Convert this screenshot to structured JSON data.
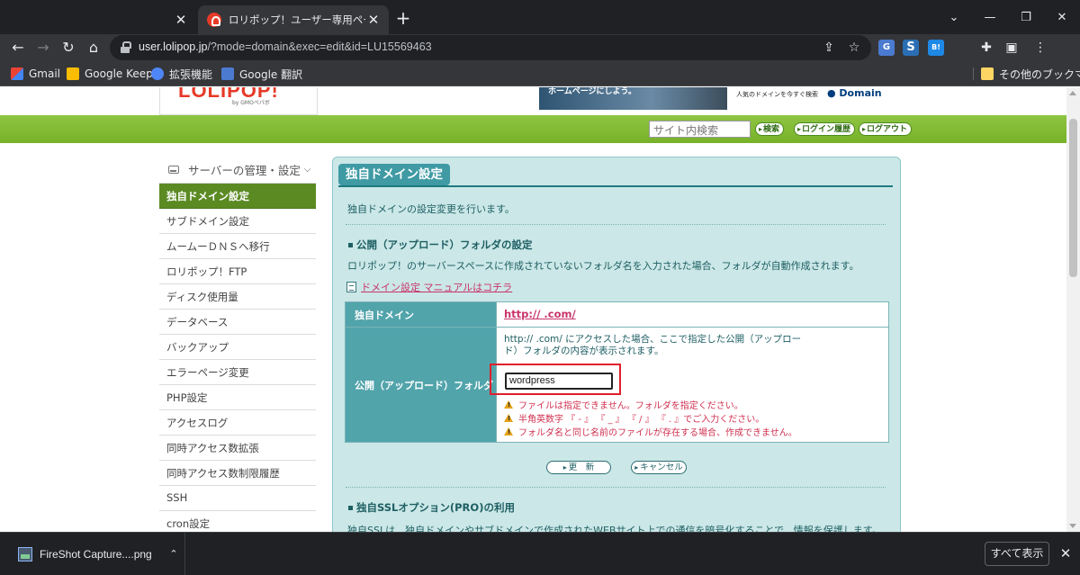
{
  "browser": {
    "tabs": [
      {
        "title": "",
        "active": false
      },
      {
        "title": "ロリポップ！ユーザー専用ページ - 独自",
        "active": true
      }
    ],
    "url_host": "user.lolipop.jp",
    "url_path": "/?mode=domain&exec=edit&id=LU15569463",
    "bookmarks": [
      "Gmail",
      "Google Keep",
      "拡張機能",
      "Google 翻訳"
    ],
    "other_bookmarks": "その他のブックマーク"
  },
  "site": {
    "logo": "LOLIPOP!",
    "logo_sub": "by GMOペパボ",
    "banner_left": "ホームページにしよう。",
    "banner_right": "人気のドメインを今すぐ検索",
    "banner_brand": "● Domain",
    "search_placeholder": "サイト内検索",
    "search_button": "検索",
    "login_history_button": "ログイン履歴",
    "logout_button": "ログアウト"
  },
  "sidebar": {
    "header": "サーバーの管理・設定",
    "items": [
      "独自ドメイン設定",
      "サブドメイン設定",
      "ムームーＤＮＳへ移行",
      "ロリポップ！FTP",
      "ディスク使用量",
      "データベース",
      "バックアップ",
      "エラーページ変更",
      "PHP設定",
      "アクセスログ",
      "同時アクセス数拡張",
      "同時アクセス数制限履歴",
      "SSH",
      "cron設定"
    ]
  },
  "main": {
    "title": "独自ドメイン設定",
    "description": "独自ドメインの設定変更を行います。",
    "section1_heading": "公開（アップロード）フォルダの設定",
    "section1_text": "ロリポップ！のサーバースペースに作成されていないフォルダ名を入力された場合、フォルダが自動作成されます。",
    "manual_link": "ドメイン設定 マニュアルはコチラ",
    "row1_label": "独自ドメイン",
    "row1_value": "http://                         .com/",
    "row2_label": "公開（アップロード）フォルダ",
    "row2_note_line1": "http://                    .com/ にアクセスした場合、ここで指定した公開（アップロー",
    "row2_note_line2": "ド）フォルダの内容が表示されます。",
    "folder_value": "wordpress",
    "warnings": [
      "ファイルは指定できません。フォルダを指定ください。",
      "半角英数字 『 - 』 『 _ 』 『 / 』 『 . 』でご入力ください。",
      "フォルダ名と同じ名前のファイルが存在する場合、作成できません。"
    ],
    "update_button": "更　新",
    "cancel_button": "キャンセル",
    "section2_heading": "独自SSLオプション(PRO)の利用",
    "section2_text": "独自SSLは、独自ドメインやサブドメインで作成されたWEBサイト上での通信を暗号化することで、情報を保護します。"
  },
  "downloads": {
    "file": "FireShot Capture....png",
    "show_all": "すべて表示"
  }
}
